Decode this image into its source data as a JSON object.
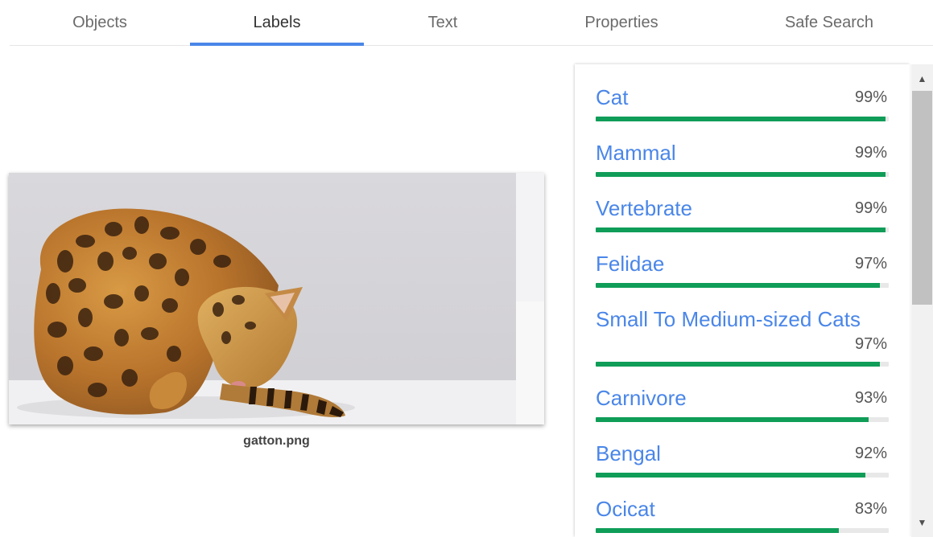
{
  "tabs": [
    {
      "label": "Objects"
    },
    {
      "label": "Labels"
    },
    {
      "label": "Text"
    },
    {
      "label": "Properties"
    },
    {
      "label": "Safe Search"
    }
  ],
  "active_tab": "Labels",
  "image": {
    "filename": "gatton.png"
  },
  "labels": [
    {
      "name": "Cat",
      "score": "99%",
      "fraction": 0.99
    },
    {
      "name": "Mammal",
      "score": "99%",
      "fraction": 0.99
    },
    {
      "name": "Vertebrate",
      "score": "99%",
      "fraction": 0.99
    },
    {
      "name": "Felidae",
      "score": "97%",
      "fraction": 0.97
    },
    {
      "name": "Small To Medium-sized Cats",
      "score": "97%",
      "fraction": 0.97
    },
    {
      "name": "Carnivore",
      "score": "93%",
      "fraction": 0.93
    },
    {
      "name": "Bengal",
      "score": "92%",
      "fraction": 0.92
    },
    {
      "name": "Ocicat",
      "score": "83%",
      "fraction": 0.83
    }
  ],
  "icons": {
    "scroll_up": "triangle-up-icon",
    "scroll_down": "triangle-down-icon"
  },
  "colors": {
    "accent": "#4a86e8",
    "bar": "#0f9d58",
    "bar_track": "#e8e8e8"
  }
}
